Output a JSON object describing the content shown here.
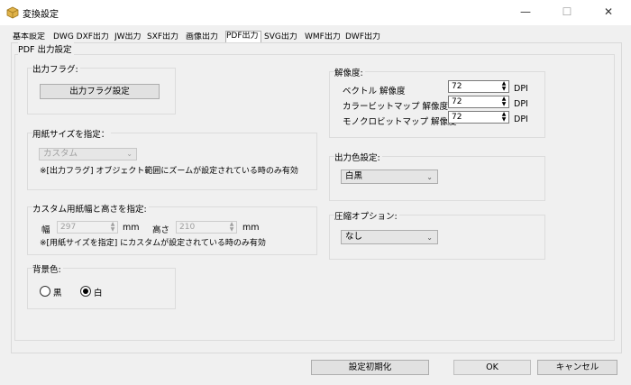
{
  "window": {
    "title": "変換設定",
    "minimize": "—",
    "maximize": "☐",
    "close": "✕"
  },
  "tabs": [
    {
      "label": "基本設定"
    },
    {
      "label": "DWG DXF出力"
    },
    {
      "label": "JW出力"
    },
    {
      "label": "SXF出力"
    },
    {
      "label": "画像出力"
    },
    {
      "label": "PDF出力"
    },
    {
      "label": "SVG出力"
    },
    {
      "label": "WMF出力"
    },
    {
      "label": "DWF出力"
    }
  ],
  "panel": {
    "title": "PDF 出力設定",
    "output_flag": {
      "label": "出力フラグ:",
      "button": "出力フラグ設定"
    },
    "paper_size": {
      "label": "用紙サイズを指定：",
      "value": "カスタム",
      "note": "※[出力フラグ] オブジェクト範囲にズームが設定されている時のみ有効"
    },
    "custom_size": {
      "label": "カスタム用紙幅と高さを指定:",
      "width_label": "幅",
      "width_value": "297",
      "width_unit": "mm",
      "height_label": "高さ",
      "height_value": "210",
      "height_unit": "mm",
      "note": "※[用紙サイズを指定] にカスタムが設定されている時のみ有効"
    },
    "background": {
      "label": "背景色:",
      "options": [
        "黒",
        "白"
      ],
      "selected": "白"
    },
    "resolution": {
      "label": "解像度:",
      "rows": [
        {
          "label": "ベクトル 解像度",
          "value": "72",
          "unit": "DPI"
        },
        {
          "label": "カラービットマップ 解像度",
          "value": "72",
          "unit": "DPI"
        },
        {
          "label": "モノクロビットマップ 解像度",
          "value": "72",
          "unit": "DPI"
        }
      ]
    },
    "output_color": {
      "label": "出力色設定:",
      "value": "白黒"
    },
    "compression": {
      "label": "圧縮オプション:",
      "value": "なし"
    }
  },
  "footer": {
    "reset": "設定初期化",
    "ok": "OK",
    "cancel": "キャンセル"
  }
}
